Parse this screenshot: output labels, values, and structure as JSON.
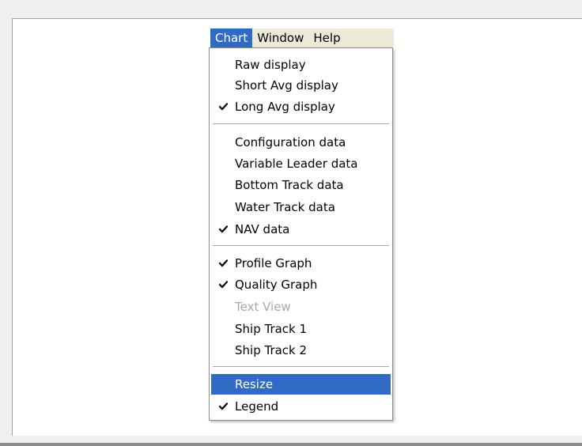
{
  "menubar": {
    "items": [
      {
        "label": "Chart"
      },
      {
        "label": "Window"
      },
      {
        "label": "Help"
      }
    ]
  },
  "chart_menu": {
    "items": [
      {
        "label": "Raw display",
        "checked": false,
        "enabled": true
      },
      {
        "label": "Short Avg display",
        "checked": false,
        "enabled": true
      },
      {
        "label": "Long Avg display",
        "checked": true,
        "enabled": true
      },
      {
        "label": "Configuration data",
        "checked": false,
        "enabled": true
      },
      {
        "label": "Variable Leader data",
        "checked": false,
        "enabled": true
      },
      {
        "label": "Bottom Track data",
        "checked": false,
        "enabled": true
      },
      {
        "label": "Water Track data",
        "checked": false,
        "enabled": true
      },
      {
        "label": "NAV data",
        "checked": true,
        "enabled": true
      },
      {
        "label": "Profile Graph",
        "checked": true,
        "enabled": true
      },
      {
        "label": "Quality Graph",
        "checked": true,
        "enabled": true
      },
      {
        "label": "Text View",
        "checked": false,
        "enabled": false
      },
      {
        "label": "Ship Track 1",
        "checked": false,
        "enabled": true
      },
      {
        "label": "Ship Track 2",
        "checked": false,
        "enabled": true
      },
      {
        "label": "Resize",
        "checked": false,
        "enabled": true,
        "highlighted": true
      },
      {
        "label": "Legend",
        "checked": true,
        "enabled": true
      }
    ],
    "check_icon": "checkmark-icon"
  },
  "colors": {
    "highlight": "#316ac5",
    "disabled_text": "#a8a8a8",
    "menubar_bg": "#ece9d8"
  }
}
